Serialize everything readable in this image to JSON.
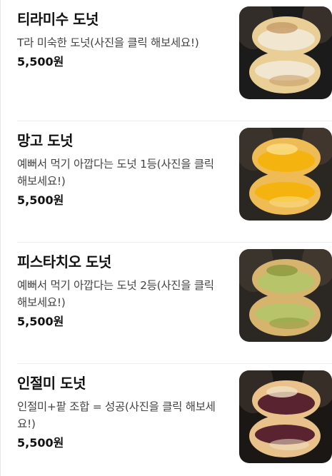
{
  "menu": {
    "items": [
      {
        "name": "티라미수 도넛",
        "description": "T라 미숙한 도넛(사진을 클릭 해보세요!)",
        "price": "5,500원",
        "photo": {
          "dough": "#e9cf95",
          "filling": "#f1e6cf",
          "accent": "#c69a66",
          "bg": "#1b1b1b"
        }
      },
      {
        "name": "망고 도넛",
        "description": "예뻐서 먹기 아깝다는 도넛 1등(사진을 클릭 해보세요!)",
        "price": "5,500원",
        "photo": {
          "dough": "#eebb55",
          "filling": "#f5b30f",
          "accent": "#fbe08a",
          "bg": "#2a2622"
        }
      },
      {
        "name": "피스타치오 도넛",
        "description": "예뻐서 먹기 아깝다는 도넛 2등(사진을 클릭 해보세요!)",
        "price": "5,500원",
        "photo": {
          "dough": "#d7b46e",
          "filling": "#b8c46a",
          "accent": "#8a9a3c",
          "bg": "#2b2823"
        }
      },
      {
        "name": "인절미 도넛",
        "description": "인절미+팥 조합 = 성공(사진을 클릭 해보세요!)",
        "price": "5,500원",
        "photo": {
          "dough": "#e8c28a",
          "filling": "#5a2330",
          "accent": "#efe1c4",
          "bg": "#1a1715"
        }
      }
    ]
  }
}
